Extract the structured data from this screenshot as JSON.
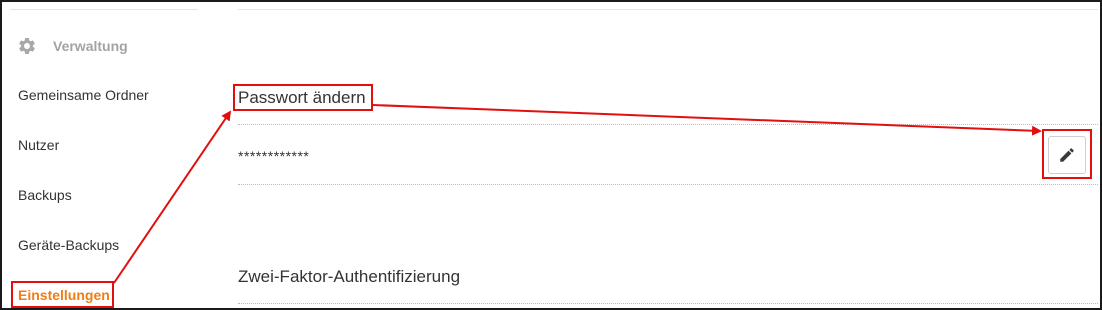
{
  "sidebar": {
    "section_header": {
      "icon": "gear-icon",
      "label": "Verwaltung"
    },
    "items": [
      {
        "label": "Gemeinsame Ordner",
        "active": false
      },
      {
        "label": "Nutzer",
        "active": false
      },
      {
        "label": "Backups",
        "active": false
      },
      {
        "label": "Geräte-Backups",
        "active": false
      },
      {
        "label": "Einstellungen",
        "active": true
      }
    ]
  },
  "main": {
    "password_section": {
      "title": "Passwort ändern",
      "masked_value": "************",
      "edit_icon": "pencil-icon"
    },
    "two_factor_section": {
      "title": "Zwei-Faktor-Authentifizierung"
    }
  },
  "colors": {
    "active_nav": "#f07d16",
    "annotation": "#e01010",
    "muted_header": "#a3a3a3",
    "text": "#333333"
  }
}
